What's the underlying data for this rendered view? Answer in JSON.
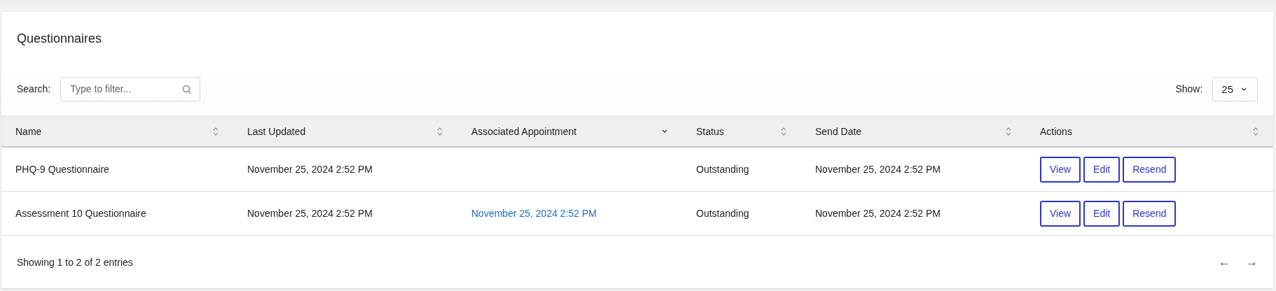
{
  "panel": {
    "title": "Questionnaires"
  },
  "search": {
    "label": "Search:",
    "placeholder": "Type to filter..."
  },
  "page_size": {
    "label": "Show:",
    "value": "25"
  },
  "table": {
    "columns": [
      {
        "label": "Name",
        "sorted": false
      },
      {
        "label": "Last Updated",
        "sorted": false
      },
      {
        "label": "Associated Appointment",
        "sorted": true
      },
      {
        "label": "Status",
        "sorted": false
      },
      {
        "label": "Send Date",
        "sorted": false
      },
      {
        "label": "Actions",
        "sorted": false
      }
    ],
    "rows": [
      {
        "cells": [
          {
            "kind": "text",
            "text": "PHQ-9 Questionnaire"
          },
          {
            "kind": "text",
            "text": "November 25, 2024 2:52 PM"
          },
          {
            "kind": "empty"
          },
          {
            "kind": "text",
            "text": "Outstanding"
          },
          {
            "kind": "text",
            "text": "November 25, 2024 2:52 PM"
          }
        ],
        "actions": [
          "View",
          "Edit",
          "Resend"
        ]
      },
      {
        "cells": [
          {
            "kind": "text",
            "text": "Assessment 10 Questionnaire"
          },
          {
            "kind": "text",
            "text": "November 25, 2024 2:52 PM"
          },
          {
            "kind": "link",
            "text": "November 25, 2024 2:52 PM"
          },
          {
            "kind": "text",
            "text": "Outstanding"
          },
          {
            "kind": "text",
            "text": "November 25, 2024 2:52 PM"
          }
        ],
        "actions": [
          "View",
          "Edit",
          "Resend"
        ]
      }
    ]
  },
  "footer": {
    "info": "Showing 1 to 2 of 2 entries",
    "prev": "←",
    "next": "→"
  }
}
